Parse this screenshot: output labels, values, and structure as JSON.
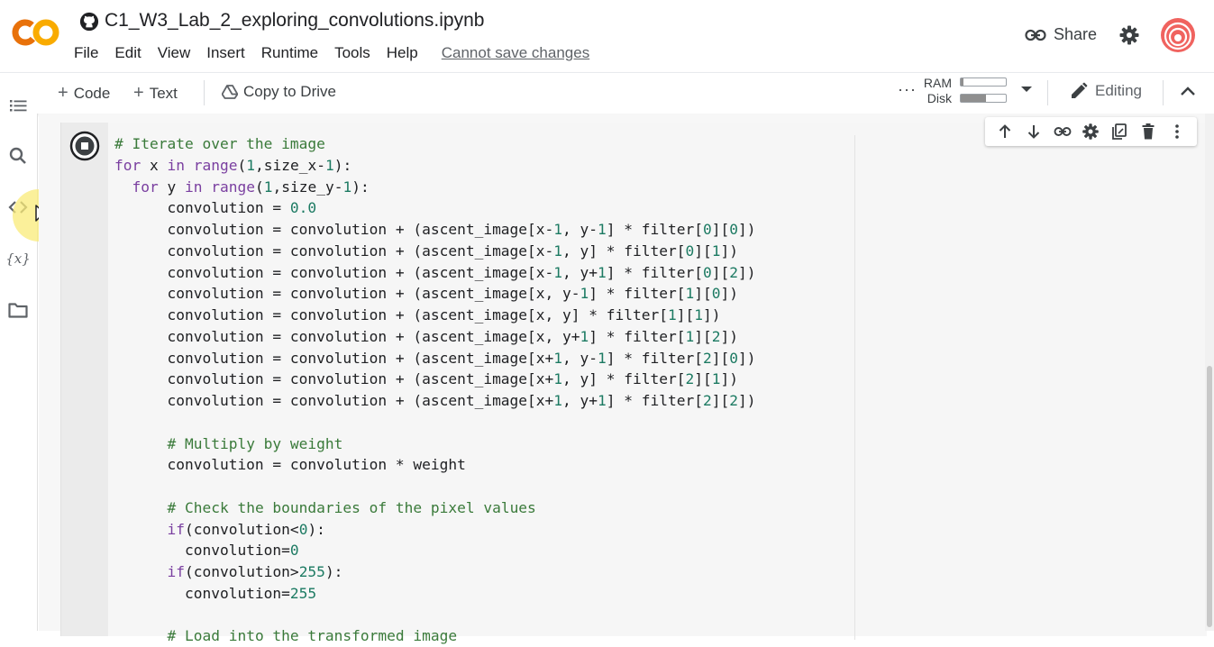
{
  "brand": {
    "logo_text": "CO",
    "logo_color": "#F9AB00",
    "logo_color2": "#E8710A"
  },
  "notebook": {
    "title": "C1_W3_Lab_2_exploring_convolutions.ipynb",
    "source_icon": "github-icon"
  },
  "menu": {
    "items": [
      "File",
      "Edit",
      "View",
      "Insert",
      "Runtime",
      "Tools",
      "Help"
    ],
    "save_status": "Cannot save changes"
  },
  "header_actions": {
    "share_label": "Share",
    "settings_icon": "gear-icon",
    "avatar_icon": "user-avatar"
  },
  "toolbar": {
    "add_code_label": "Code",
    "add_text_label": "Text",
    "copy_to_drive_label": "Copy to Drive",
    "more_label": "···",
    "ram_label": "RAM",
    "disk_label": "Disk",
    "ram_usage": 0.05,
    "disk_usage": 0.55,
    "editing_label": "Editing"
  },
  "rail": {
    "icons": [
      "table-of-contents-icon",
      "search-icon",
      "code-snippets-icon",
      "variables-icon",
      "files-icon"
    ],
    "variables_text": "{x}"
  },
  "cell_toolbar": {
    "icons": [
      "move-up-icon",
      "move-down-icon",
      "link-icon",
      "cell-settings-icon",
      "mirror-cell-icon",
      "delete-icon",
      "more-icon"
    ]
  },
  "code_lines": [
    [
      [
        "cm",
        "# Iterate over the image"
      ]
    ],
    [
      [
        "kw",
        "for"
      ],
      [
        "",
        " x "
      ],
      [
        "kw",
        "in"
      ],
      [
        "",
        " "
      ],
      [
        "fn",
        "range"
      ],
      [
        "",
        "("
      ],
      [
        "nm",
        "1"
      ],
      [
        "",
        ",size_x-"
      ],
      [
        "nm",
        "1"
      ],
      [
        "",
        "):"
      ]
    ],
    [
      [
        "",
        "  "
      ],
      [
        "kw",
        "for"
      ],
      [
        "",
        " y "
      ],
      [
        "kw",
        "in"
      ],
      [
        "",
        " "
      ],
      [
        "fn",
        "range"
      ],
      [
        "",
        "("
      ],
      [
        "nm",
        "1"
      ],
      [
        "",
        ",size_y-"
      ],
      [
        "nm",
        "1"
      ],
      [
        "",
        "):"
      ]
    ],
    [
      [
        "",
        "      convolution = "
      ],
      [
        "nm",
        "0.0"
      ]
    ],
    [
      [
        "",
        "      convolution = convolution + (ascent_image[x-"
      ],
      [
        "nm",
        "1"
      ],
      [
        "",
        ", y-"
      ],
      [
        "nm",
        "1"
      ],
      [
        "",
        "] * filter["
      ],
      [
        "nm",
        "0"
      ],
      [
        "",
        "]["
      ],
      [
        "nm",
        "0"
      ],
      [
        "",
        "])"
      ]
    ],
    [
      [
        "",
        "      convolution = convolution + (ascent_image[x-"
      ],
      [
        "nm",
        "1"
      ],
      [
        "",
        ", y] * filter["
      ],
      [
        "nm",
        "0"
      ],
      [
        "",
        "]["
      ],
      [
        "nm",
        "1"
      ],
      [
        "",
        "])"
      ]
    ],
    [
      [
        "",
        "      convolution = convolution + (ascent_image[x-"
      ],
      [
        "nm",
        "1"
      ],
      [
        "",
        ", y+"
      ],
      [
        "nm",
        "1"
      ],
      [
        "",
        "] * filter["
      ],
      [
        "nm",
        "0"
      ],
      [
        "",
        "]["
      ],
      [
        "nm",
        "2"
      ],
      [
        "",
        "])"
      ]
    ],
    [
      [
        "",
        "      convolution = convolution + (ascent_image[x, y-"
      ],
      [
        "nm",
        "1"
      ],
      [
        "",
        "] * filter["
      ],
      [
        "nm",
        "1"
      ],
      [
        "",
        "]["
      ],
      [
        "nm",
        "0"
      ],
      [
        "",
        "])"
      ]
    ],
    [
      [
        "",
        "      convolution = convolution + (ascent_image[x, y] * filter["
      ],
      [
        "nm",
        "1"
      ],
      [
        "",
        "]["
      ],
      [
        "nm",
        "1"
      ],
      [
        "",
        "])"
      ]
    ],
    [
      [
        "",
        "      convolution = convolution + (ascent_image[x, y+"
      ],
      [
        "nm",
        "1"
      ],
      [
        "",
        "] * filter["
      ],
      [
        "nm",
        "1"
      ],
      [
        "",
        "]["
      ],
      [
        "nm",
        "2"
      ],
      [
        "",
        "])"
      ]
    ],
    [
      [
        "",
        "      convolution = convolution + (ascent_image[x+"
      ],
      [
        "nm",
        "1"
      ],
      [
        "",
        ", y-"
      ],
      [
        "nm",
        "1"
      ],
      [
        "",
        "] * filter["
      ],
      [
        "nm",
        "2"
      ],
      [
        "",
        "]["
      ],
      [
        "nm",
        "0"
      ],
      [
        "",
        "])"
      ]
    ],
    [
      [
        "",
        "      convolution = convolution + (ascent_image[x+"
      ],
      [
        "nm",
        "1"
      ],
      [
        "",
        ", y] * filter["
      ],
      [
        "nm",
        "2"
      ],
      [
        "",
        "]["
      ],
      [
        "nm",
        "1"
      ],
      [
        "",
        "])"
      ]
    ],
    [
      [
        "",
        "      convolution = convolution + (ascent_image[x+"
      ],
      [
        "nm",
        "1"
      ],
      [
        "",
        ", y+"
      ],
      [
        "nm",
        "1"
      ],
      [
        "",
        "] * filter["
      ],
      [
        "nm",
        "2"
      ],
      [
        "",
        "]["
      ],
      [
        "nm",
        "2"
      ],
      [
        "",
        "])"
      ]
    ],
    [
      [
        "",
        ""
      ]
    ],
    [
      [
        "",
        "      "
      ],
      [
        "cm",
        "# Multiply by weight"
      ]
    ],
    [
      [
        "",
        "      convolution = convolution * weight"
      ]
    ],
    [
      [
        "",
        ""
      ]
    ],
    [
      [
        "",
        "      "
      ],
      [
        "cm",
        "# Check the boundaries of the pixel values"
      ]
    ],
    [
      [
        "",
        "      "
      ],
      [
        "kw",
        "if"
      ],
      [
        "",
        "(convolution<"
      ],
      [
        "nm",
        "0"
      ],
      [
        "",
        "):"
      ]
    ],
    [
      [
        "",
        "        convolution="
      ],
      [
        "nm",
        "0"
      ]
    ],
    [
      [
        "",
        "      "
      ],
      [
        "kw",
        "if"
      ],
      [
        "",
        "(convolution>"
      ],
      [
        "nm",
        "255"
      ],
      [
        "",
        "):"
      ]
    ],
    [
      [
        "",
        "        convolution="
      ],
      [
        "nm",
        "255"
      ]
    ],
    [
      [
        "",
        ""
      ]
    ],
    [
      [
        "",
        "      "
      ],
      [
        "cm",
        "# Load into the transformed image"
      ]
    ]
  ]
}
